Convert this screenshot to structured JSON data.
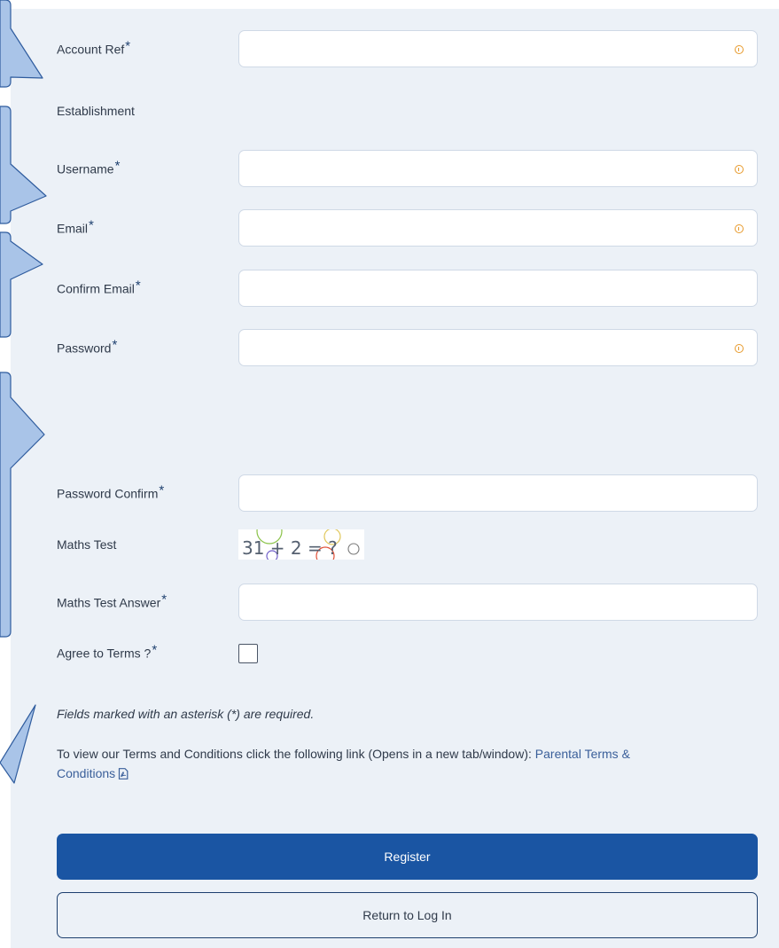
{
  "form": {
    "required_marker": "*",
    "fields": {
      "account_ref": {
        "label": "Account Ref",
        "value": "",
        "has_info": true
      },
      "establishment": {
        "label": "Establishment"
      },
      "username": {
        "label": "Username",
        "value": "",
        "has_info": true
      },
      "email": {
        "label": "Email",
        "value": "",
        "has_info": true
      },
      "confirm_email": {
        "label": "Confirm Email",
        "value": "",
        "has_info": false
      },
      "password": {
        "label": "Password",
        "value": "",
        "has_info": true
      },
      "password_confirm": {
        "label": "Password Confirm",
        "value": "",
        "has_info": false
      },
      "maths_test": {
        "label": "Maths Test",
        "captcha_text": "31 + 2 = ?"
      },
      "maths_test_answer": {
        "label": "Maths Test Answer",
        "value": "",
        "has_info": false
      },
      "agree_terms": {
        "label": "Agree to Terms ?",
        "checked": false
      }
    },
    "required_note": "Fields marked with an asterisk (*) are required.",
    "terms_text": "To view our Terms and Conditions click the following link (Opens in a new tab/window):",
    "terms_link_part1": "Parental Terms &",
    "terms_link_part2": "Conditions",
    "register_label": "Register",
    "return_label": "Return to Log In"
  },
  "colors": {
    "panel_bg": "#ecf1f7",
    "primary": "#1a55a3",
    "info_icon": "#e89a2c",
    "callout_fill": "#a9c4e8",
    "callout_stroke": "#2f5c9e"
  },
  "icons": {
    "field_info": "info-circle-icon",
    "terms_pdf": "pdf-file-icon"
  }
}
